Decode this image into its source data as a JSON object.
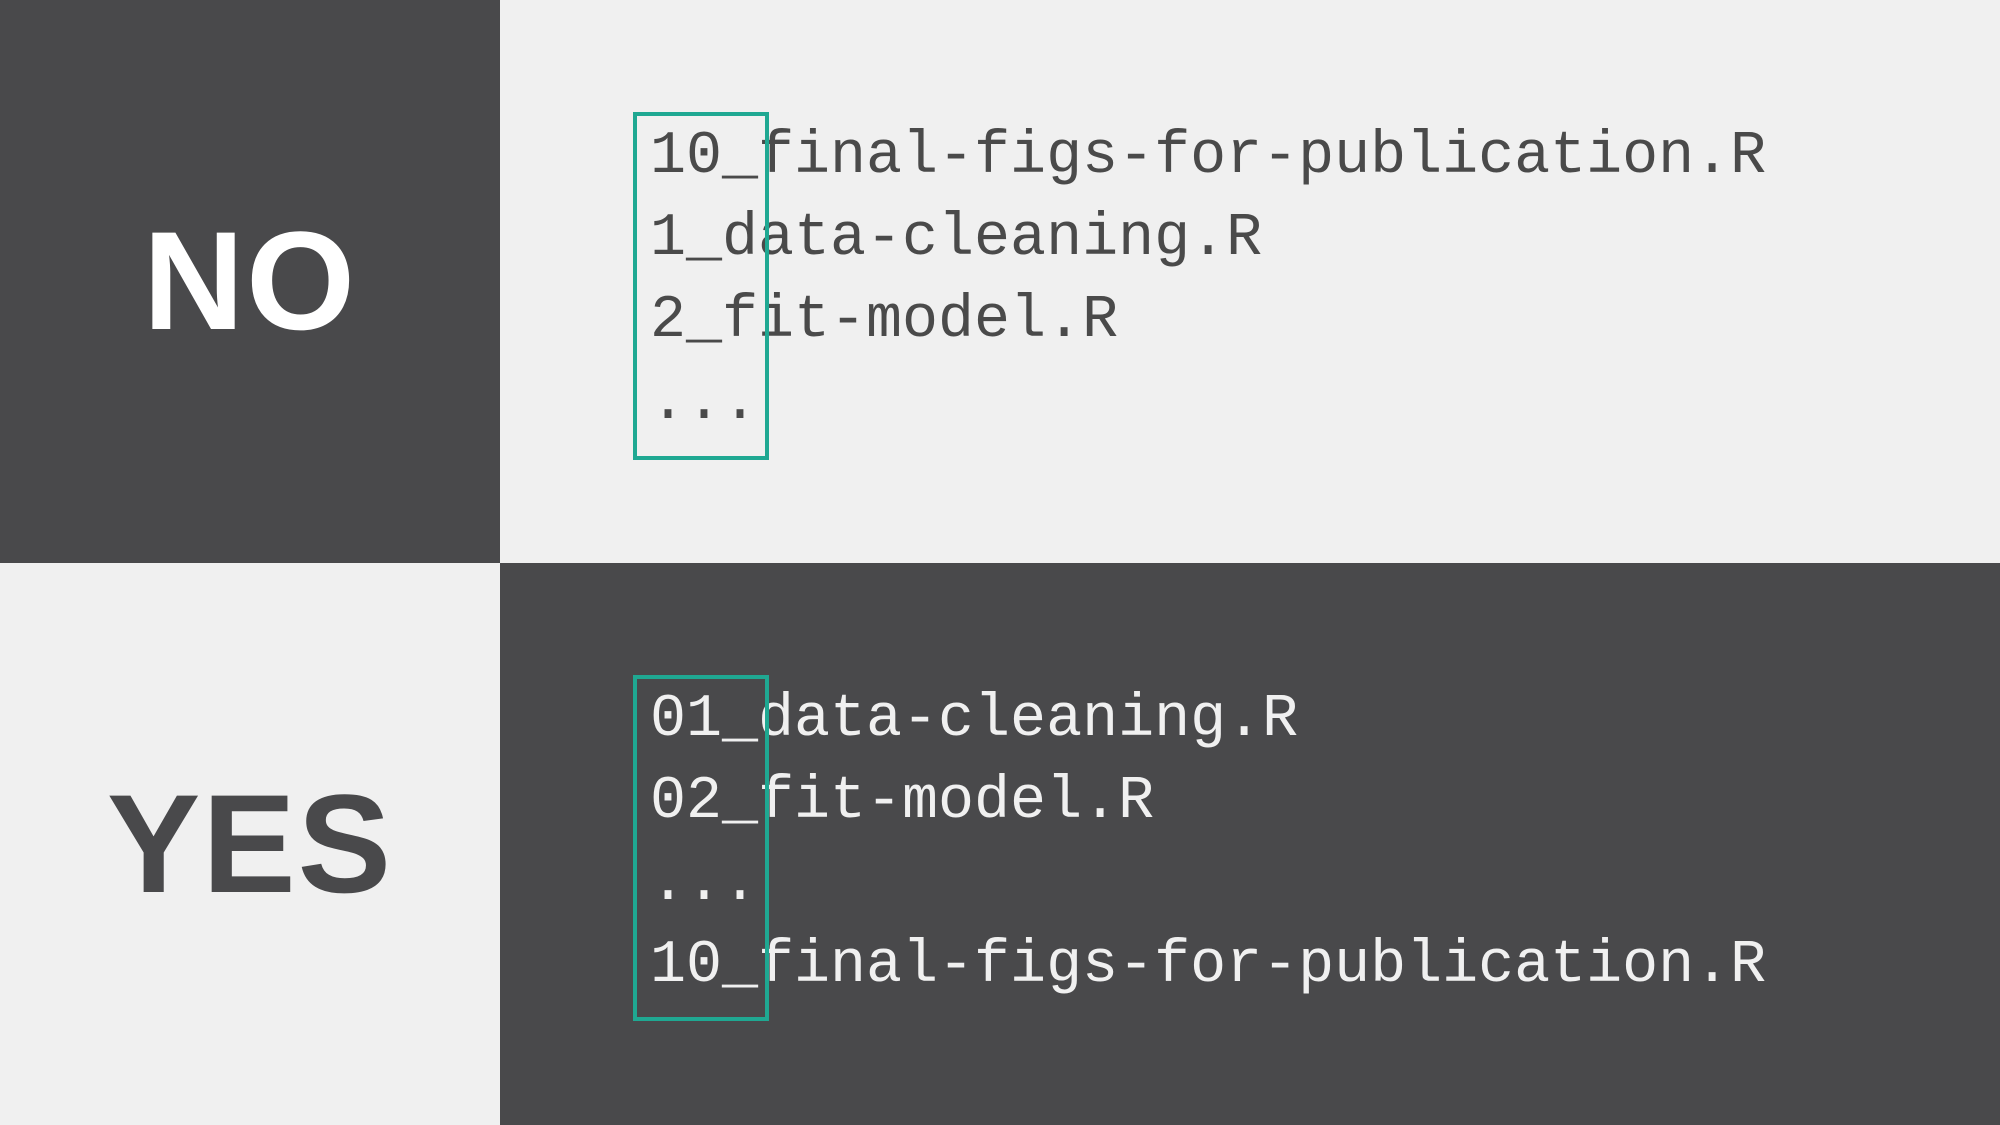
{
  "labels": {
    "no": "NO",
    "yes": "YES"
  },
  "no_example": {
    "lines": [
      "10_final-figs-for-publication.R",
      "1_data-cleaning.R",
      "2_fit-model.R",
      "..."
    ]
  },
  "yes_example": {
    "lines": [
      "01_data-cleaning.R",
      "02_fit-model.R",
      "...",
      "10_final-figs-for-publication.R"
    ]
  },
  "colors": {
    "dark": "#49494b",
    "light": "#f0f0f0",
    "accent": "#1fa892",
    "white": "#ffffff"
  }
}
